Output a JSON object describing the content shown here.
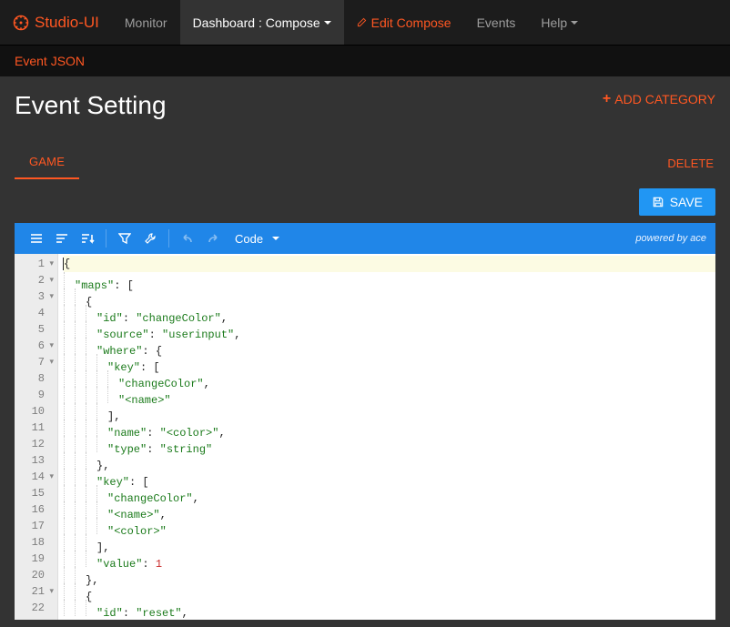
{
  "brand": "Studio-UI",
  "nav": {
    "monitor": "Monitor",
    "dashboard": "Dashboard : Compose",
    "edit_compose": "Edit Compose",
    "events": "Events",
    "help": "Help"
  },
  "subnav": {
    "event_json": "Event JSON"
  },
  "page": {
    "title": "Event Setting",
    "add_category": "ADD CATEGORY",
    "delete": "DELETE",
    "save": "SAVE",
    "tab_game": "GAME"
  },
  "editor": {
    "mode": "Code",
    "powered_by": "powered by ace"
  },
  "code_lines": [
    {
      "n": 1,
      "fold": true,
      "hl": true,
      "tokens": [
        {
          "t": "pn",
          "v": "{"
        }
      ]
    },
    {
      "n": 2,
      "fold": true,
      "indent": 1,
      "tokens": [
        {
          "t": "key",
          "v": "\"maps\""
        },
        {
          "t": "pn",
          "v": ": ["
        }
      ]
    },
    {
      "n": 3,
      "fold": true,
      "indent": 2,
      "tokens": [
        {
          "t": "pn",
          "v": "{"
        }
      ]
    },
    {
      "n": 4,
      "indent": 3,
      "tokens": [
        {
          "t": "key",
          "v": "\"id\""
        },
        {
          "t": "pn",
          "v": ": "
        },
        {
          "t": "str",
          "v": "\"changeColor\""
        },
        {
          "t": "pn",
          "v": ","
        }
      ]
    },
    {
      "n": 5,
      "indent": 3,
      "tokens": [
        {
          "t": "key",
          "v": "\"source\""
        },
        {
          "t": "pn",
          "v": ": "
        },
        {
          "t": "str",
          "v": "\"userinput\""
        },
        {
          "t": "pn",
          "v": ","
        }
      ]
    },
    {
      "n": 6,
      "fold": true,
      "indent": 3,
      "tokens": [
        {
          "t": "key",
          "v": "\"where\""
        },
        {
          "t": "pn",
          "v": ": {"
        }
      ]
    },
    {
      "n": 7,
      "fold": true,
      "indent": 4,
      "tokens": [
        {
          "t": "key",
          "v": "\"key\""
        },
        {
          "t": "pn",
          "v": ": ["
        }
      ]
    },
    {
      "n": 8,
      "indent": 5,
      "tokens": [
        {
          "t": "str",
          "v": "\"changeColor\""
        },
        {
          "t": "pn",
          "v": ","
        }
      ]
    },
    {
      "n": 9,
      "indent": 5,
      "tokens": [
        {
          "t": "str",
          "v": "\"<name>\""
        }
      ]
    },
    {
      "n": 10,
      "indent": 4,
      "tokens": [
        {
          "t": "pn",
          "v": "],"
        }
      ]
    },
    {
      "n": 11,
      "indent": 4,
      "tokens": [
        {
          "t": "key",
          "v": "\"name\""
        },
        {
          "t": "pn",
          "v": ": "
        },
        {
          "t": "str",
          "v": "\"<color>\""
        },
        {
          "t": "pn",
          "v": ","
        }
      ]
    },
    {
      "n": 12,
      "indent": 4,
      "tokens": [
        {
          "t": "key",
          "v": "\"type\""
        },
        {
          "t": "pn",
          "v": ": "
        },
        {
          "t": "str",
          "v": "\"string\""
        }
      ]
    },
    {
      "n": 13,
      "indent": 3,
      "tokens": [
        {
          "t": "pn",
          "v": "},"
        }
      ]
    },
    {
      "n": 14,
      "fold": true,
      "indent": 3,
      "tokens": [
        {
          "t": "key",
          "v": "\"key\""
        },
        {
          "t": "pn",
          "v": ": ["
        }
      ]
    },
    {
      "n": 15,
      "indent": 4,
      "tokens": [
        {
          "t": "str",
          "v": "\"changeColor\""
        },
        {
          "t": "pn",
          "v": ","
        }
      ]
    },
    {
      "n": 16,
      "indent": 4,
      "tokens": [
        {
          "t": "str",
          "v": "\"<name>\""
        },
        {
          "t": "pn",
          "v": ","
        }
      ]
    },
    {
      "n": 17,
      "indent": 4,
      "tokens": [
        {
          "t": "str",
          "v": "\"<color>\""
        }
      ]
    },
    {
      "n": 18,
      "indent": 3,
      "tokens": [
        {
          "t": "pn",
          "v": "],"
        }
      ]
    },
    {
      "n": 19,
      "indent": 3,
      "tokens": [
        {
          "t": "key",
          "v": "\"value\""
        },
        {
          "t": "pn",
          "v": ": "
        },
        {
          "t": "num",
          "v": "1"
        }
      ]
    },
    {
      "n": 20,
      "indent": 2,
      "tokens": [
        {
          "t": "pn",
          "v": "},"
        }
      ]
    },
    {
      "n": 21,
      "fold": true,
      "indent": 2,
      "tokens": [
        {
          "t": "pn",
          "v": "{"
        }
      ]
    },
    {
      "n": 22,
      "indent": 3,
      "tokens": [
        {
          "t": "key",
          "v": "\"id\""
        },
        {
          "t": "pn",
          "v": ": "
        },
        {
          "t": "str",
          "v": "\"reset\""
        },
        {
          "t": "pn",
          "v": ","
        }
      ]
    }
  ]
}
